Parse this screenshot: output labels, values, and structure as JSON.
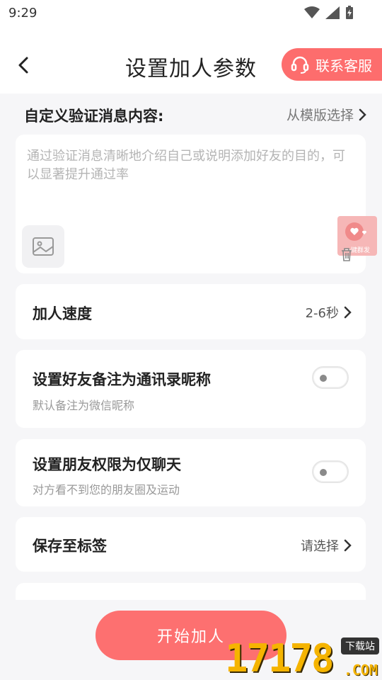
{
  "status": {
    "time": "9:29"
  },
  "header": {
    "title": "设置加人参数",
    "contact_label": "联系客服"
  },
  "message": {
    "section_title": "自定义验证消息内容:",
    "template_link": "从模版选择",
    "placeholder": "通过验证消息清晰地介绍自己或说明添加好友的目的，可以显著提升通过率"
  },
  "float_widget": {
    "label": "一键群发"
  },
  "rows": {
    "speed": {
      "label": "加人速度",
      "value": "2-6秒"
    },
    "remark": {
      "label": "设置好友备注为通讯录昵称",
      "sub": "默认备注为微信昵称",
      "enabled": false
    },
    "chat_only": {
      "label": "设置朋友权限为仅聊天",
      "sub": "对方看不到您的朋友圈及运动",
      "enabled": false
    },
    "tag": {
      "label": "保存至标签",
      "value": "请选择"
    }
  },
  "start_button": {
    "label": "开始加人"
  },
  "watermark": {
    "number": "17178",
    "tag": "下载站",
    "suffix": ".COM"
  },
  "colors": {
    "accent": "#fd6d6d",
    "background": "#f6f6f8"
  }
}
